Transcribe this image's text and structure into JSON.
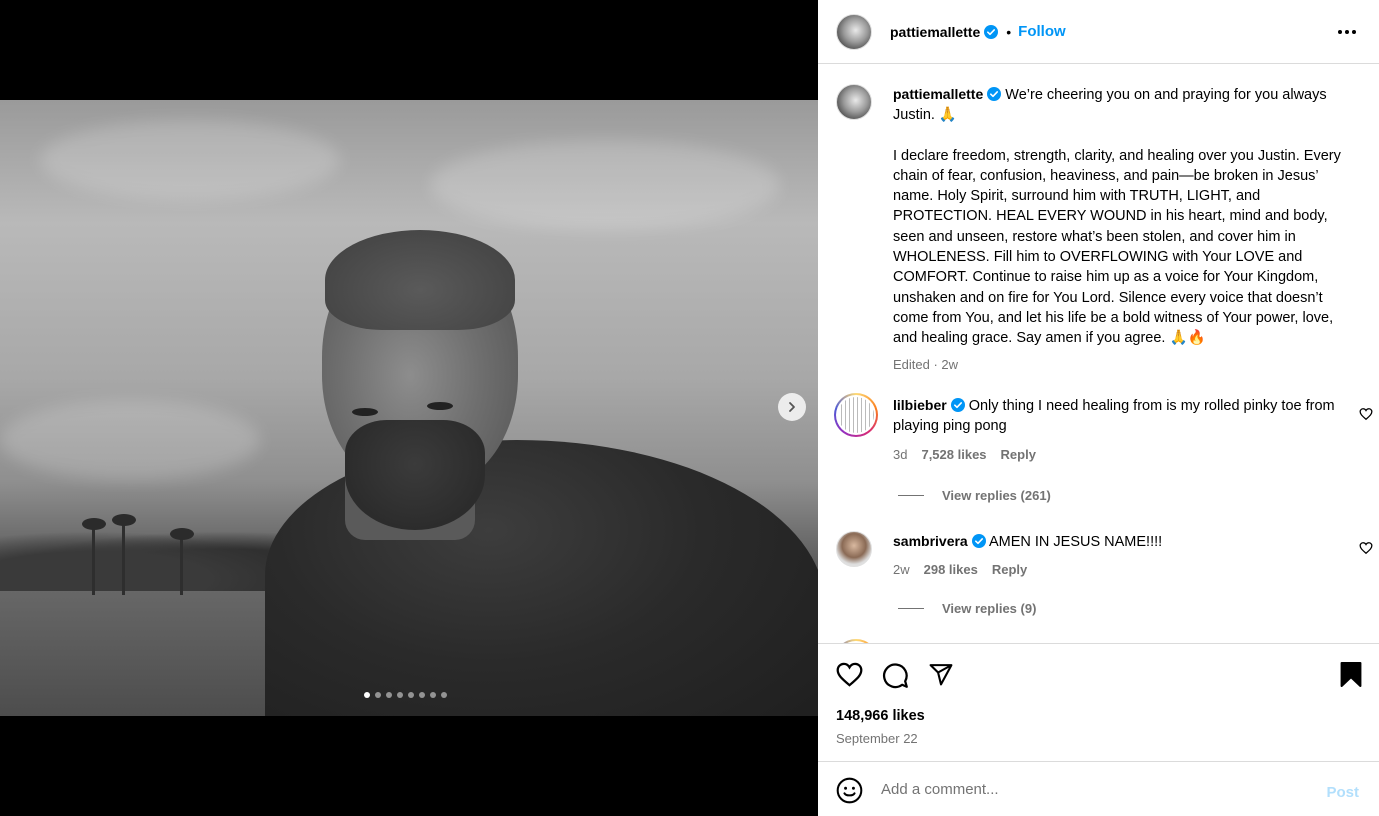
{
  "post": {
    "username": "pattiemallette",
    "follow_label": "Follow",
    "separator": "•",
    "carousel": {
      "slide_count": 8,
      "active_index": 0
    }
  },
  "caption": {
    "username": "pattiemallette",
    "line1": "We’re cheering you on and praying for you always Justin. 🙏",
    "paragraph": "I declare freedom, strength, clarity, and healing over you Justin. Every chain of fear, confusion, heaviness, and pain—be broken in Jesus’ name. Holy Spirit, surround him with TRUTH, LIGHT, and PROTECTION. HEAL EVERY WOUND in his heart, mind and body, seen and unseen, restore what’s been stolen, and cover him in WHOLENESS. Fill him to OVERFLOWING with Your LOVE and COMFORT. Continue to raise him up as a voice for Your Kingdom, unshaken and on fire for You Lord. Silence every voice that doesn’t come from You, and let his life be a bold witness of Your power, love, and healing grace. Say amen if you agree. 🙏🔥",
    "meta": "Edited · 2w"
  },
  "comments": [
    {
      "username": "lilbieber",
      "text": "Only thing I need healing from is my rolled pinky toe from playing ping pong",
      "age": "3d",
      "likes": "7,528 likes",
      "reply_label": "Reply",
      "view_replies": "View replies (261)"
    },
    {
      "username": "sambrivera",
      "text": "AMEN IN JESUS NAME!!!!",
      "age": "2w",
      "likes": "298 likes",
      "reply_label": "Reply",
      "view_replies": "View replies (9)"
    }
  ],
  "footer": {
    "likes": "148,966 likes",
    "date": "September 22",
    "comment_placeholder": "Add a comment...",
    "post_label": "Post"
  },
  "colors": {
    "link_blue": "#0095f6",
    "verified_blue": "#0095f6",
    "muted_text": "#737373",
    "border": "#dbdbdb"
  },
  "icons": [
    "more-icon",
    "verified-icon",
    "heart-icon",
    "comment-icon",
    "share-icon",
    "bookmark-icon",
    "emoji-icon",
    "chevron-right-icon"
  ]
}
